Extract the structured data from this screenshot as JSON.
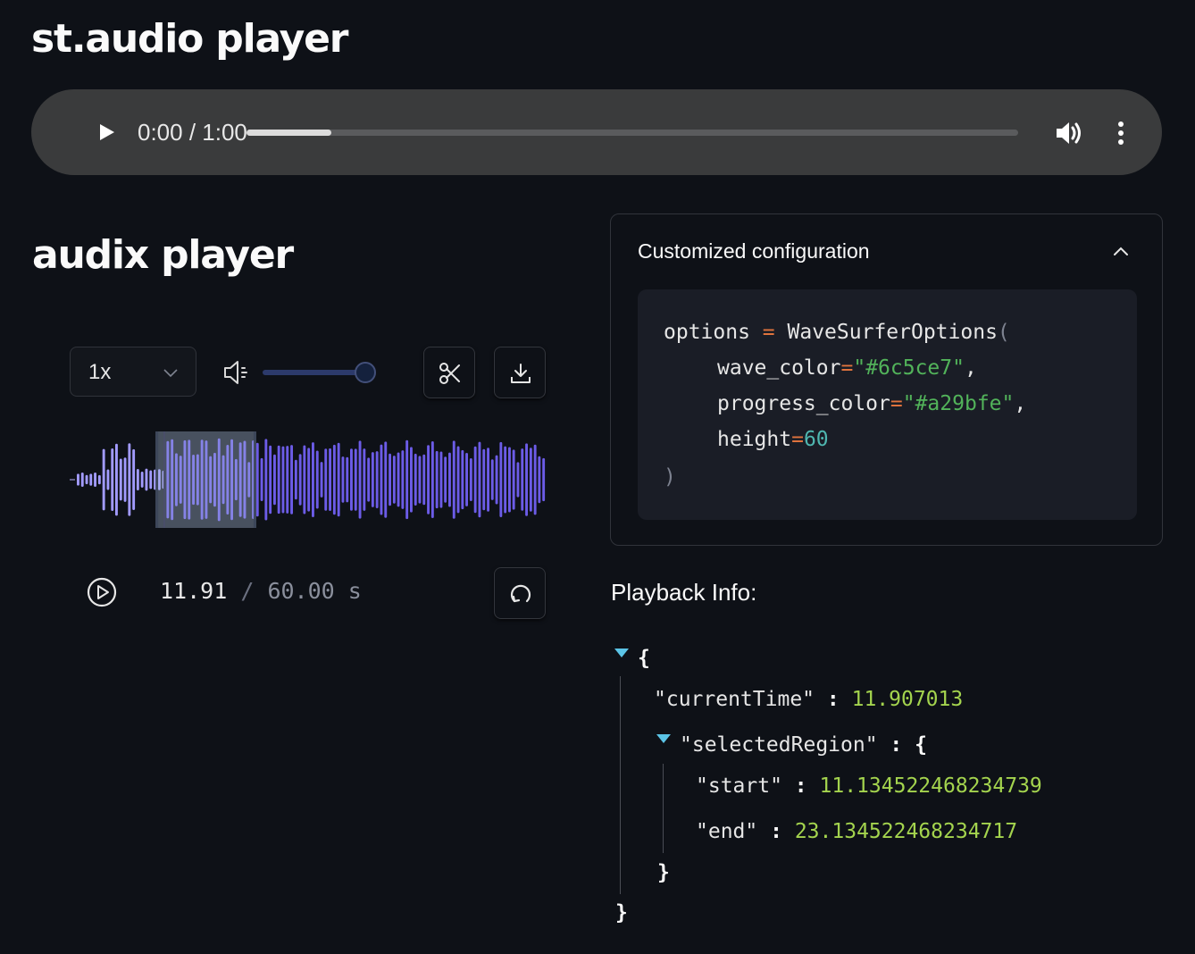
{
  "st_audio": {
    "heading": "st.audio player",
    "time_display": "0:00 / 1:00",
    "progress_fraction": 0.11
  },
  "audix": {
    "heading": "audix player",
    "speed": "1x",
    "volume_fraction": 0.93,
    "current_time": "11.91",
    "separator": "/",
    "total_time": "60.00",
    "time_unit": "s",
    "waveform": {
      "wave_color": "#6c5ce7",
      "progress_color": "#a29bfe",
      "progress_seconds": 11.907013,
      "duration_seconds": 60.0,
      "region_start_seconds": 11.134522468234739,
      "region_end_seconds": 23.134522468234717
    }
  },
  "config": {
    "title": "Customized configuration",
    "code": {
      "line1_var": "options",
      "line1_op": "=",
      "line1_call": "WaveSurferOptions",
      "line1_paren": "(",
      "line2_key": "wave_color",
      "line2_val": "\"#6c5ce7\"",
      "line3_key": "progress_color",
      "line3_val": "\"#a29bfe\"",
      "line4_key": "height",
      "line4_val": "60",
      "op_eq": "=",
      "comma": ",",
      "close": ")"
    }
  },
  "playback": {
    "label": "Playback Info:",
    "json": {
      "open_brace": "{",
      "close_brace": "}",
      "current_time_key": "\"currentTime\"",
      "current_time_val": "11.907013",
      "selected_region_key": "\"selectedRegion\"",
      "start_key": "\"start\"",
      "start_val": "11.134522468234739",
      "end_key": "\"end\"",
      "end_val": "23.134522468234717",
      "colon": ":"
    }
  },
  "colors": {
    "background": "#0e1117",
    "wave": "#6c5ce7",
    "progress": "#a29bfe",
    "json_number": "#a4d44e",
    "code_string": "#52b35a",
    "code_operator": "#e0733d"
  }
}
